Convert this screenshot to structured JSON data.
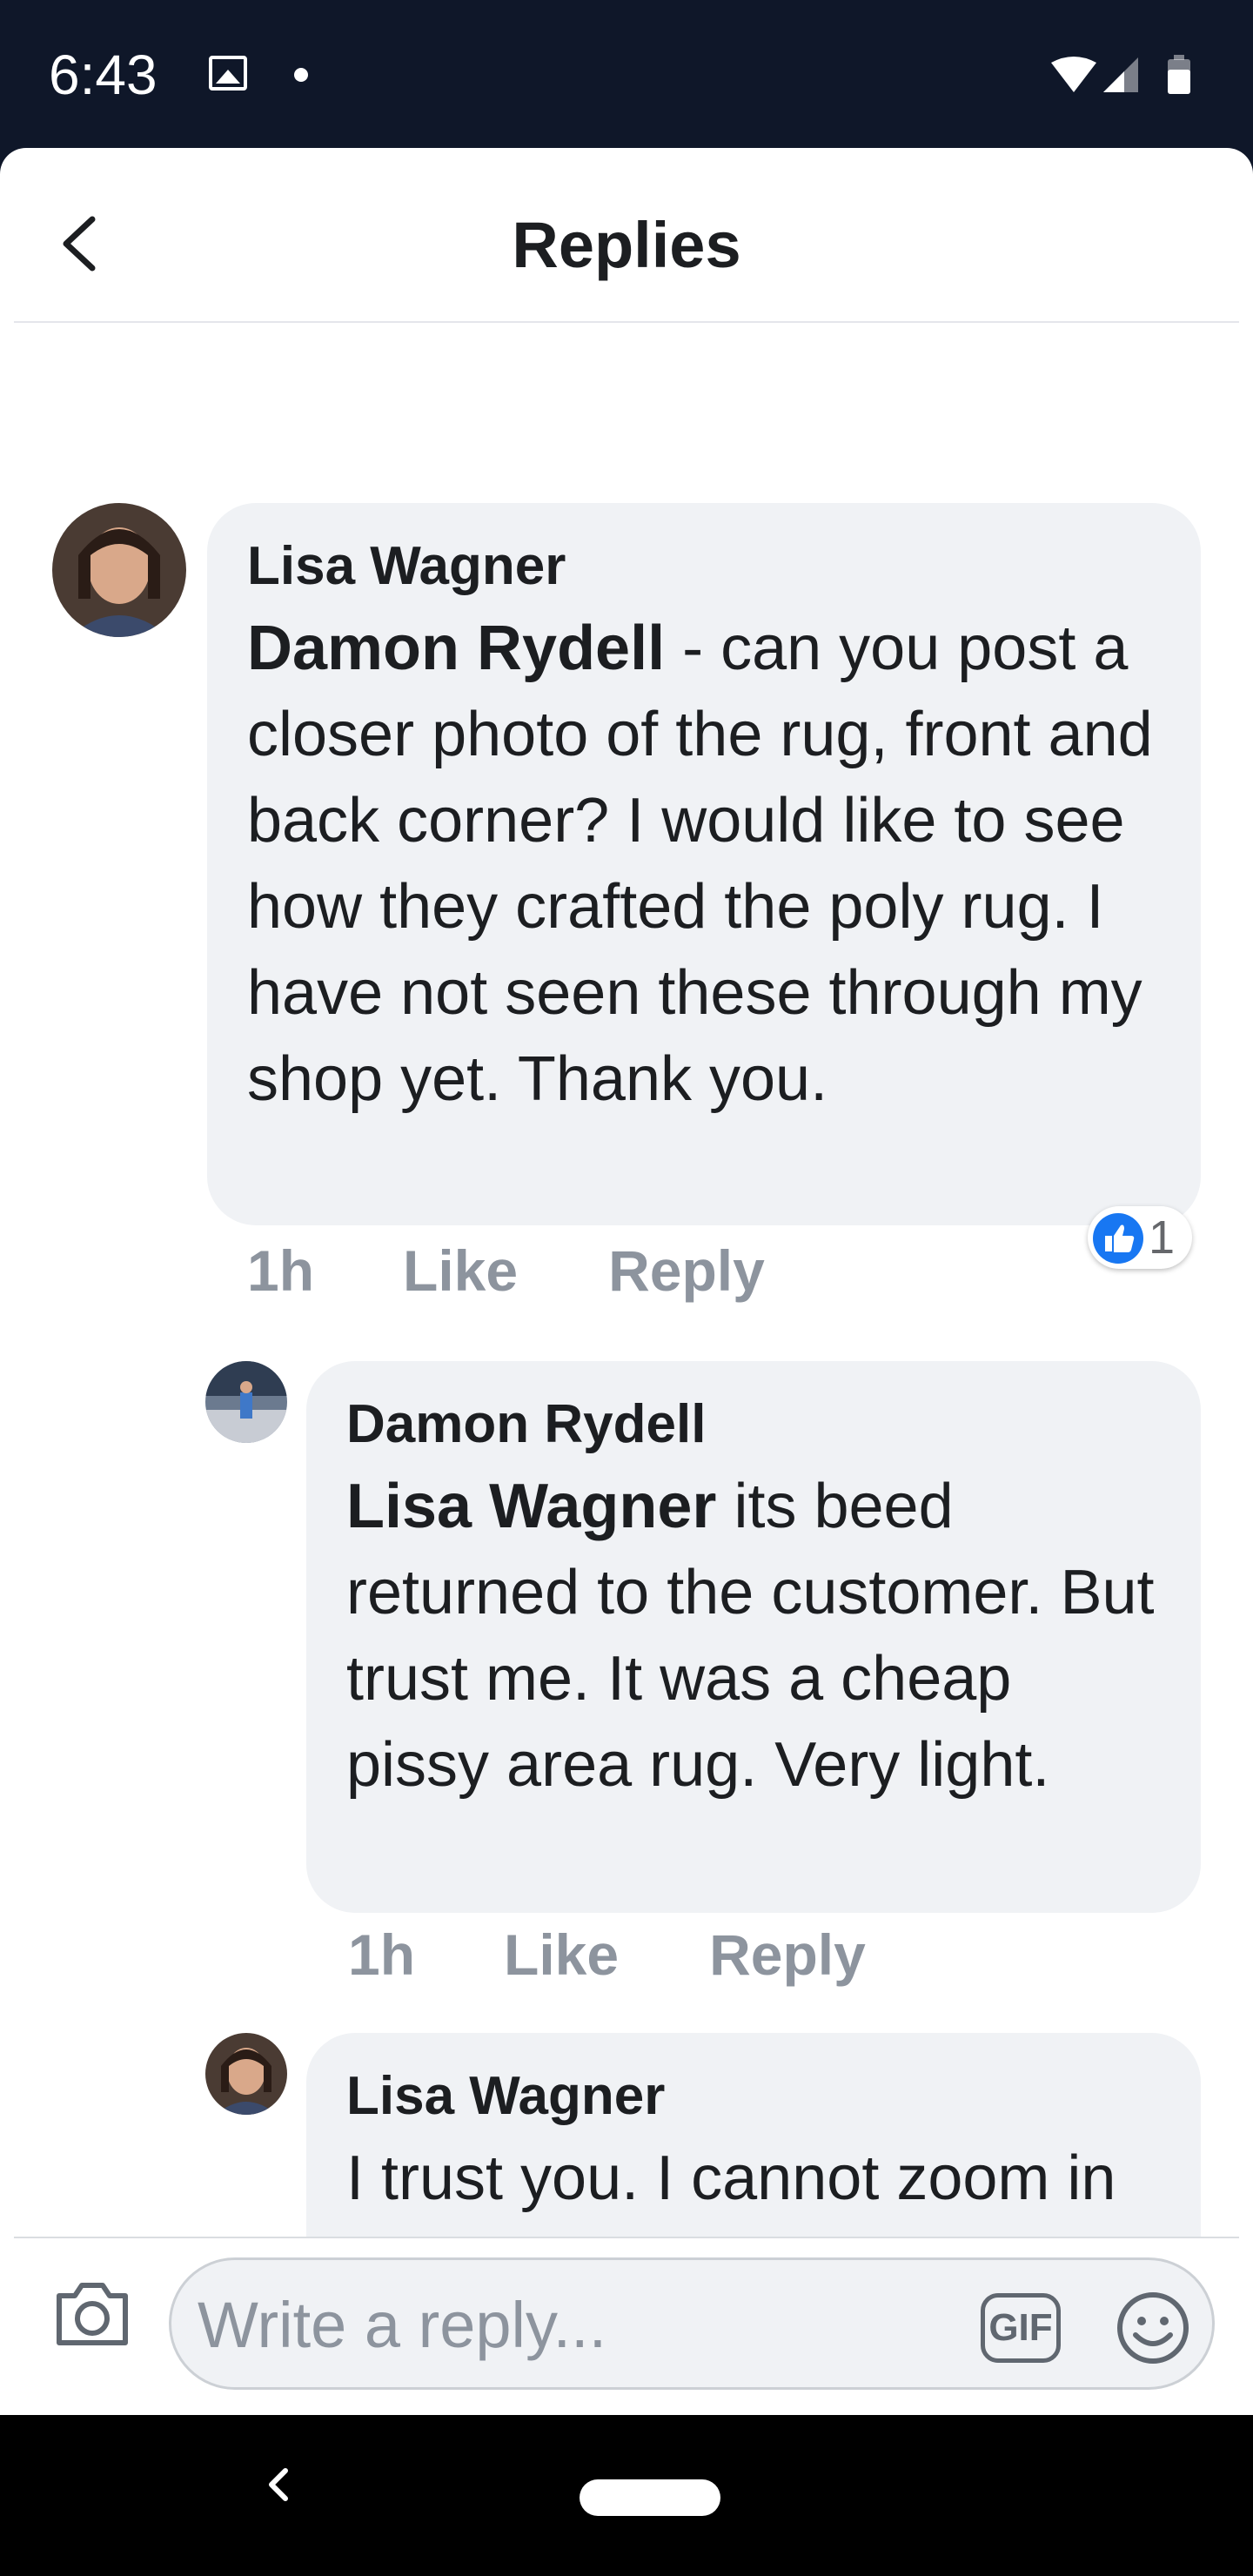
{
  "status_bar": {
    "time": "6:43"
  },
  "header": {
    "title": "Replies"
  },
  "comments": [
    {
      "author": "Lisa Wagner",
      "mention": "Damon Rydell",
      "body": " - can you post a closer photo of the rug, front and back corner? I would like to see how they crafted the poly rug. I have not seen these through my shop yet. Thank you.",
      "time": "1h",
      "like_label": "Like",
      "reply_label": "Reply",
      "reaction_count": "1"
    },
    {
      "author": "Damon Rydell",
      "mention": "Lisa Wagner",
      "body": " its beed returned to the customer. But trust me. It was a cheap pissy area rug. Very light.",
      "time": "1h",
      "like_label": "Like",
      "reply_label": "Reply"
    },
    {
      "author": "Lisa Wagner",
      "body": "I trust you. I cannot zoom in on my phone, so I can't tell what the pile is like."
    }
  ],
  "composer": {
    "placeholder": "Write a reply...",
    "gif_label": "GIF"
  },
  "icons": {
    "back": "chevron-left-icon",
    "camera": "camera-icon",
    "emoji": "smiley-icon",
    "like": "thumbs-up-icon"
  },
  "colors": {
    "like_blue": "#1877f2",
    "bubble": "#f0f2f5",
    "meta_gray": "#8d949e"
  }
}
